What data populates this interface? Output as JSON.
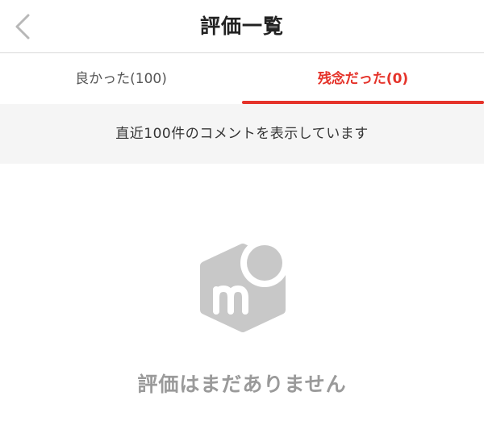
{
  "header": {
    "title": "評価一覧",
    "back_icon": "chevron-left-icon"
  },
  "tabs": [
    {
      "label": "良かった(100)",
      "active": false
    },
    {
      "label": "残念だった(0)",
      "active": true
    }
  ],
  "banner": {
    "text": "直近100件のコメントを表示しています"
  },
  "empty_state": {
    "icon": "mercari-box-logo-icon",
    "message": "評価はまだありません"
  },
  "colors": {
    "accent": "#e5332a",
    "icon_gray": "#c8c8c8",
    "message_gray": "#9a9a9a",
    "banner_bg": "#f5f5f5"
  }
}
